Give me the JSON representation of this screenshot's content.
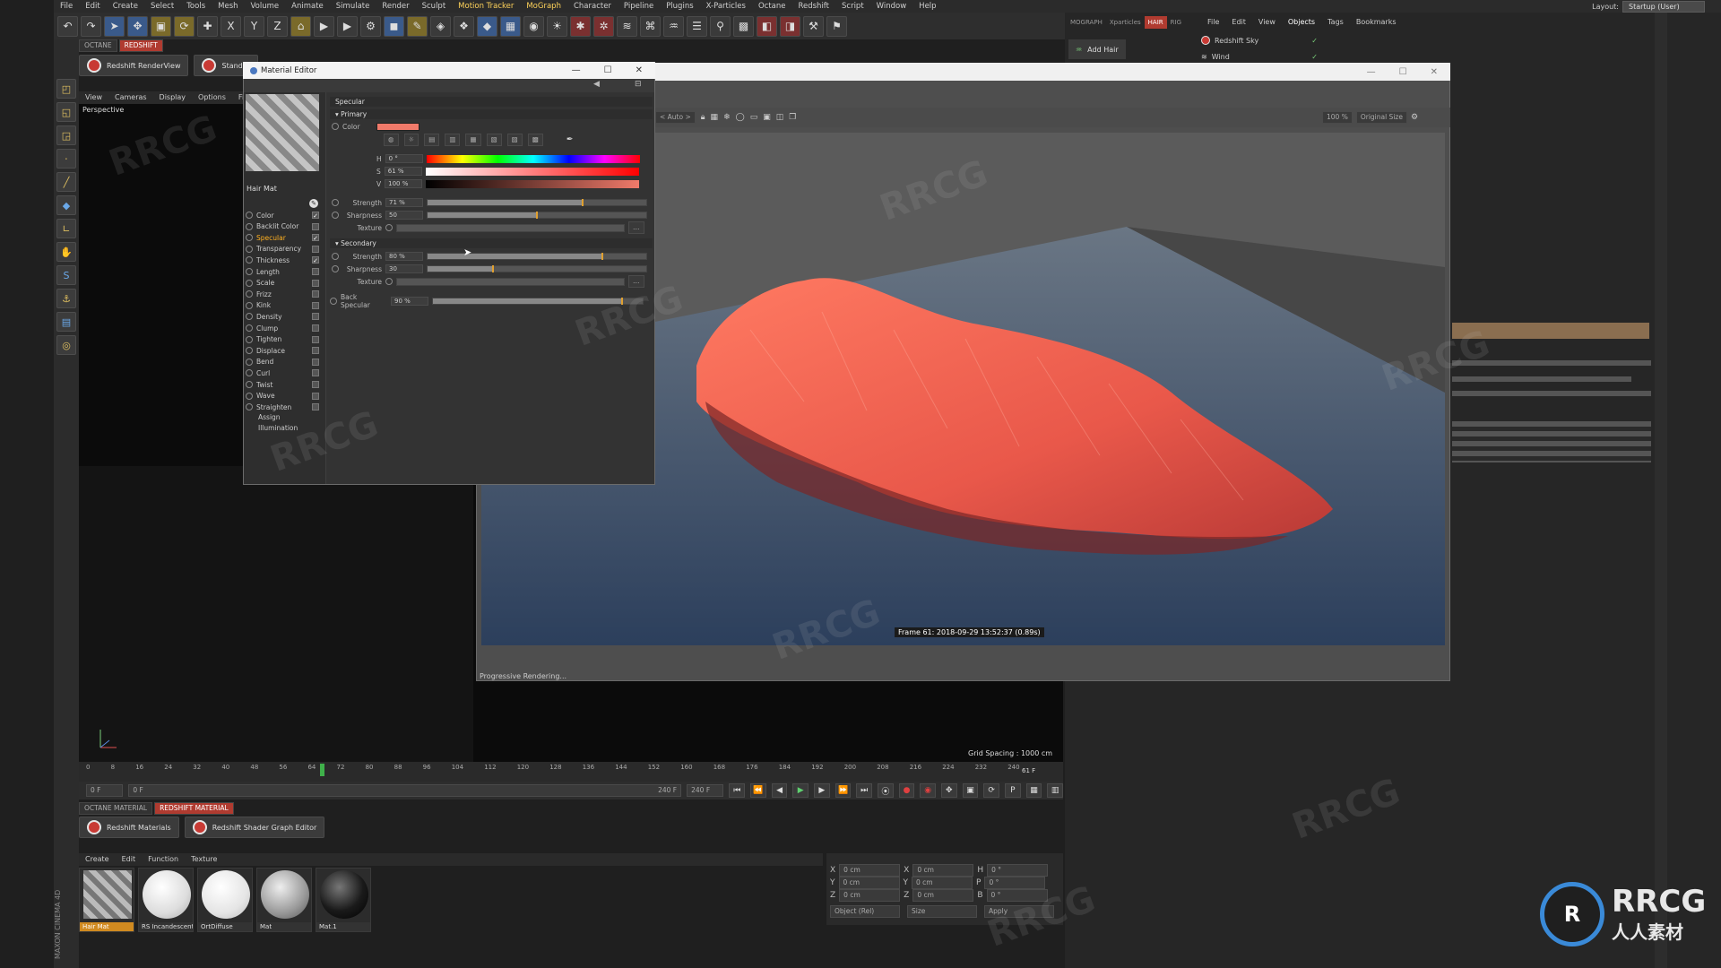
{
  "app": {
    "menu": [
      "File",
      "Edit",
      "Create",
      "Select",
      "Tools",
      "Mesh",
      "Volume",
      "Animate",
      "Simulate",
      "Render",
      "Sculpt",
      "Motion Tracker",
      "MoGraph",
      "Character",
      "Pipeline",
      "Plugins",
      "X-Particles",
      "Octane",
      "Redshift",
      "Script",
      "Window",
      "Help"
    ],
    "layout_label": "Layout:",
    "layout_value": "Startup (User)"
  },
  "plugin_tabs": [
    "OCTANE",
    "REDSHIFT"
  ],
  "plugin_buttons": {
    "renderview": "Redshift RenderView",
    "standard": "Standar"
  },
  "viewport": {
    "menu": [
      "View",
      "Cameras",
      "Display",
      "Options",
      "Filter"
    ],
    "label": "Perspective",
    "grid_spacing": "Grid Spacing : 1000 cm"
  },
  "timeline": {
    "ticks": [
      "0",
      "8",
      "16",
      "24",
      "32",
      "40",
      "48",
      "56",
      "64",
      "72",
      "80",
      "88",
      "96",
      "104",
      "112",
      "120",
      "128",
      "136",
      "144",
      "152",
      "160",
      "168",
      "176",
      "184",
      "192",
      "200",
      "208",
      "216",
      "224",
      "232",
      "240"
    ],
    "start": "0 F",
    "range_start": "0 F",
    "range_end": "240 F",
    "end": "240 F",
    "current": "61 F"
  },
  "material_manager": {
    "tabs": [
      "OCTANE MATERIAL",
      "REDSHIFT MATERIAL"
    ],
    "buttons": {
      "materials": "Redshift Materials",
      "shader_graph": "Redshift Shader Graph Editor"
    },
    "menu": [
      "Create",
      "Edit",
      "Function",
      "Texture"
    ],
    "materials": [
      {
        "name": "Hair Mat",
        "style": "stripes"
      },
      {
        "name": "RS Incandescent",
        "style": "white"
      },
      {
        "name": "OrtDiffuse",
        "style": "white-soft"
      },
      {
        "name": "Mat",
        "style": "grey"
      },
      {
        "name": "Mat.1",
        "style": "black"
      }
    ]
  },
  "coords": {
    "rows": [
      [
        "X",
        "0 cm",
        "X",
        "0 cm",
        "H",
        "0 °"
      ],
      [
        "Y",
        "0 cm",
        "Y",
        "0 cm",
        "P",
        "0 °"
      ],
      [
        "Z",
        "0 cm",
        "Z",
        "0 cm",
        "B",
        "0 °"
      ]
    ],
    "mode": "Object (Rel)",
    "size": "Size",
    "apply": "Apply"
  },
  "object_manager": {
    "left_tabs": [
      "MOGRAPH",
      "Xparticles",
      "HAIR",
      "RIG"
    ],
    "add_hair": "Add Hair",
    "menu": [
      "File",
      "Edit",
      "View",
      "Objects",
      "Tags",
      "Bookmarks"
    ],
    "objects": [
      "Redshift Sky",
      "Wind"
    ]
  },
  "render_view": {
    "camera_dropdown": "< Auto >",
    "zoom": "100 %",
    "size_dropdown": "Original Size",
    "frame_info": "Frame  61:  2018-09-29  13:52:37  (0.89s)",
    "status": "Progressive Rendering..."
  },
  "material_editor": {
    "title": "Material Editor",
    "material_name": "Hair Mat",
    "channels": [
      {
        "name": "Color",
        "checked": true,
        "active": false
      },
      {
        "name": "Backlit Color",
        "checked": false,
        "active": false
      },
      {
        "name": "Specular",
        "checked": true,
        "active": true
      },
      {
        "name": "Transparency",
        "checked": false,
        "active": false
      },
      {
        "name": "Thickness",
        "checked": true,
        "active": false
      },
      {
        "name": "Length",
        "checked": false,
        "active": false
      },
      {
        "name": "Scale",
        "checked": false,
        "active": false
      },
      {
        "name": "Frizz",
        "checked": false,
        "active": false
      },
      {
        "name": "Kink",
        "checked": false,
        "active": false
      },
      {
        "name": "Density",
        "checked": false,
        "active": false
      },
      {
        "name": "Clump",
        "checked": false,
        "active": false
      },
      {
        "name": "Tighten",
        "checked": false,
        "active": false
      },
      {
        "name": "Displace",
        "checked": false,
        "active": false
      },
      {
        "name": "Bend",
        "checked": false,
        "active": false
      },
      {
        "name": "Curl",
        "checked": false,
        "active": false
      },
      {
        "name": "Twist",
        "checked": false,
        "active": false
      },
      {
        "name": "Wave",
        "checked": false,
        "active": false
      },
      {
        "name": "Straighten",
        "checked": false,
        "active": false
      }
    ],
    "extra_items": [
      "Assign",
      "Illumination"
    ],
    "section_title": "Specular",
    "primary": {
      "label": "Primary",
      "color_label": "Color",
      "color_hex": "#f07a6a",
      "h_label": "H",
      "h_value": "0 °",
      "s_label": "S",
      "s_value": "61 %",
      "v_label": "V",
      "v_value": "100 %",
      "strength_label": "Strength",
      "strength_value": "71 %",
      "strength_frac": 0.71,
      "sharpness_label": "Sharpness",
      "sharpness_value": "50",
      "sharpness_frac": 0.5,
      "texture_label": "Texture"
    },
    "secondary": {
      "label": "Secondary",
      "strength_label": "Strength",
      "strength_value": "80 %",
      "strength_frac": 0.8,
      "sharpness_label": "Sharpness",
      "sharpness_value": "30",
      "sharpness_frac": 0.3,
      "texture_label": "Texture"
    },
    "back_specular_label": "Back Specular",
    "back_specular_value": "90 %",
    "back_specular_frac": 0.9
  },
  "branding": {
    "logo_text": "RRCG",
    "logo_sub": "人人素材",
    "side_label": "MAXON CINEMA 4D",
    "watermark": "RRCG"
  }
}
